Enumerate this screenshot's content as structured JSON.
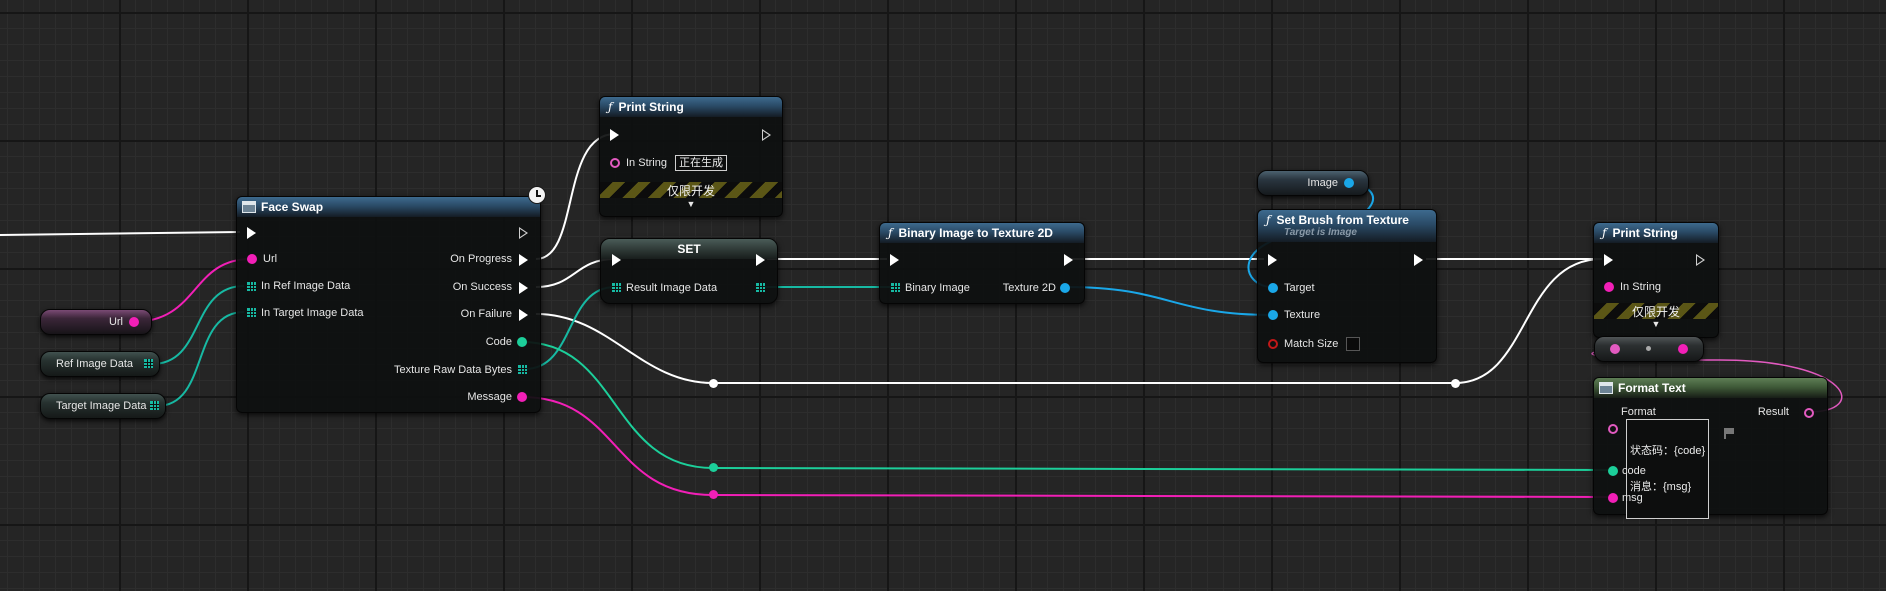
{
  "colors": {
    "exec": "#ffffff",
    "string": "#f21fb7",
    "object": "#1aa7e8",
    "integer": "#1ccf9a",
    "byte_array": "#17b9a3",
    "text": "#e25ac0",
    "boolean": "#c21818"
  },
  "icons": {
    "function": "function-icon",
    "event_node": "node-icon",
    "latent": "clock-icon",
    "expand": "chevron-down-icon",
    "localize": "flag-icon"
  },
  "variables": {
    "url": "Url",
    "ref_image_data": "Ref Image Data",
    "target_image_data": "Target Image Data",
    "image": "Image"
  },
  "face_swap": {
    "title": "Face Swap",
    "inputs": {
      "url": "Url",
      "ref": "In Ref Image Data",
      "target": "In Target Image Data"
    },
    "outputs": {
      "on_progress": "On Progress",
      "on_success": "On Success",
      "on_failure": "On Failure",
      "code": "Code",
      "texture_raw_bytes": "Texture Raw Data Bytes",
      "message": "Message"
    }
  },
  "print_string_1": {
    "title": "Print String",
    "in_string_label": "In String",
    "in_string_value": "正在生成",
    "dev_only": "仅限开发"
  },
  "set_node": {
    "title": "SET",
    "var_label": "Result Image Data"
  },
  "binary_to_texture": {
    "title": "Binary Image to Texture 2D",
    "input": "Binary Image",
    "output": "Texture 2D"
  },
  "set_brush": {
    "title": "Set Brush from Texture",
    "subtitle": "Target is Image",
    "target": "Target",
    "texture": "Texture",
    "match_size": "Match Size"
  },
  "print_string_2": {
    "title": "Print String",
    "in_string_label": "In String",
    "dev_only": "仅限开发"
  },
  "format_text": {
    "title": "Format Text",
    "format_label": "Format",
    "format_line1": "状态码：{code}",
    "format_line2": "消息：{msg}",
    "result": "Result",
    "code": "code",
    "msg": "msg"
  }
}
